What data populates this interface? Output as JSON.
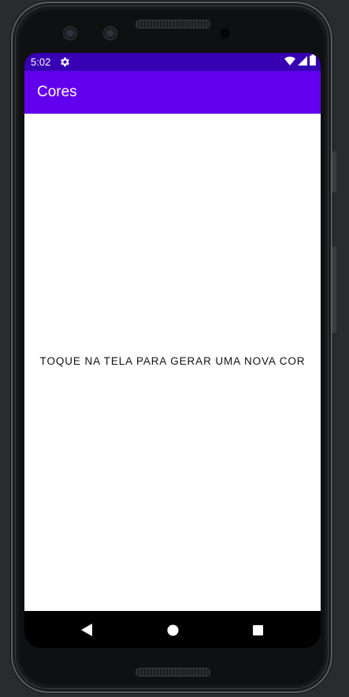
{
  "status_bar": {
    "time": "5:02",
    "icons": [
      "settings-icon",
      "wifi-icon",
      "signal-icon",
      "battery-icon"
    ],
    "color": "#3700b3"
  },
  "app_bar": {
    "title": "Cores",
    "color": "#6200ee"
  },
  "content": {
    "instruction": "TOQUE NA TELA PARA GERAR UMA NOVA COR",
    "background": "#ffffff"
  },
  "nav_bar": {
    "buttons": [
      "back-icon",
      "home-icon",
      "recents-icon"
    ]
  }
}
